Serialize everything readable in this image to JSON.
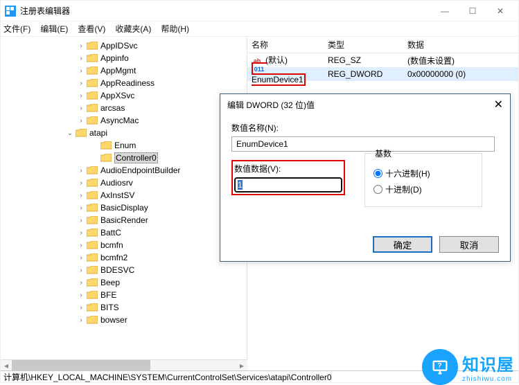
{
  "window": {
    "title": "注册表编辑器"
  },
  "menubar": {
    "file": "文件(F)",
    "edit": "编辑(E)",
    "view": "查看(V)",
    "fav": "收藏夹(A)",
    "help": "帮助(H)"
  },
  "tree": [
    "AppIDSvc",
    "Appinfo",
    "AppMgmt",
    "AppReadiness",
    "AppXSvc",
    "arcsas",
    "AsyncMac",
    "atapi",
    "Enum",
    "Controller0",
    "AudioEndpointBuilder",
    "Audiosrv",
    "AxInstSV",
    "BasicDisplay",
    "BasicRender",
    "BattC",
    "bcmfn",
    "bcmfn2",
    "BDESVC",
    "Beep",
    "BFE",
    "BITS",
    "bowser"
  ],
  "list": {
    "headers": {
      "name": "名称",
      "type": "类型",
      "data": "数据"
    },
    "rows": [
      {
        "name": "(默认)",
        "type": "REG_SZ",
        "data": "(数值未设置)",
        "icon": "str"
      },
      {
        "name": "EnumDevice1",
        "type": "REG_DWORD",
        "data": "0x00000000 (0)",
        "icon": "dword"
      }
    ]
  },
  "dialog": {
    "title": "编辑 DWORD (32 位)值",
    "nameLabel": "数值名称(N):",
    "nameValue": "EnumDevice1",
    "dataLabel": "数值数据(V):",
    "dataValue": "1",
    "baseLabel": "基数",
    "hex": "十六进制(H)",
    "dec": "十进制(D)",
    "ok": "确定",
    "cancel": "取消"
  },
  "status": "计算机\\HKEY_LOCAL_MACHINE\\SYSTEM\\CurrentControlSet\\Services\\atapi\\Controller0",
  "wm": "知识屋",
  "wm_sub": "zhishiwu.com"
}
